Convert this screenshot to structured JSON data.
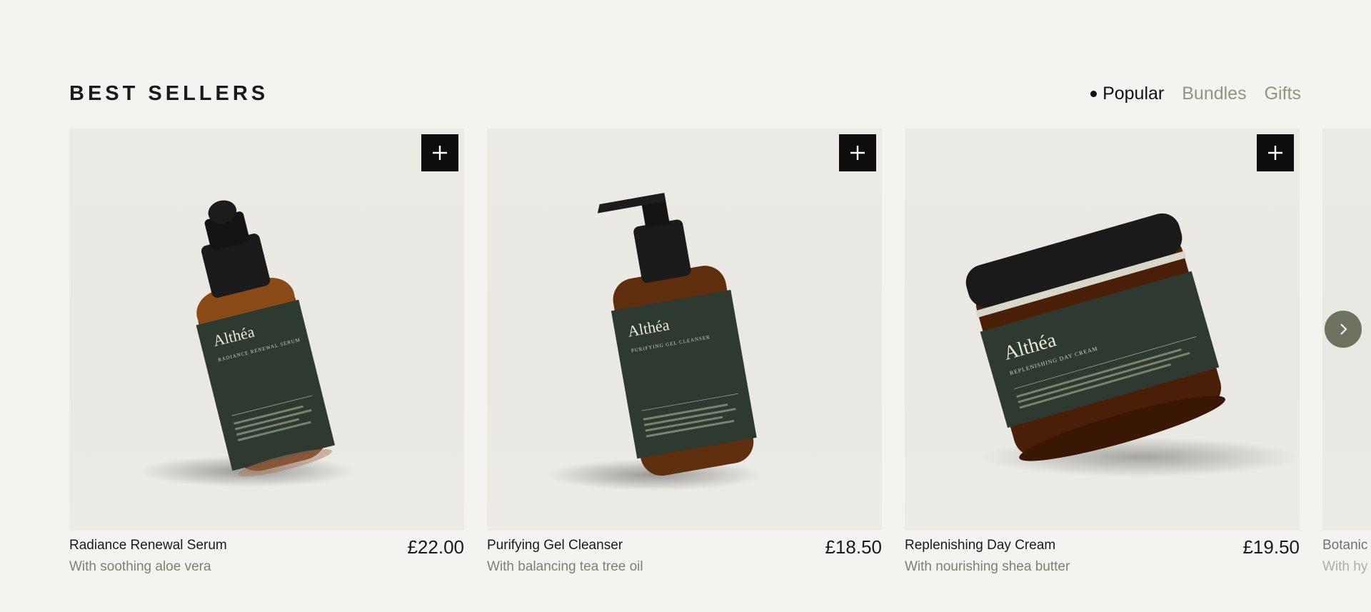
{
  "section": {
    "title": "BEST SELLERS"
  },
  "tabs": [
    {
      "label": "Popular",
      "active": true
    },
    {
      "label": "Bundles",
      "active": false
    },
    {
      "label": "Gifts",
      "active": false
    }
  ],
  "products": [
    {
      "name": "Radiance Renewal Serum",
      "description": "With soothing aloe vera",
      "price": "£22.00",
      "brand": "Althéa",
      "label_line": "RADIANCE RENEWAL SERUM"
    },
    {
      "name": "Purifying Gel Cleanser",
      "description": "With balancing tea tree oil",
      "price": "£18.50",
      "brand": "Althéa",
      "label_line": "PURIFYING GEL CLEANSER"
    },
    {
      "name": "Replenishing Day Cream",
      "description": "With nourishing shea butter",
      "price": "£19.50",
      "brand": "Althéa",
      "label_line": "REPLENISHING DAY CREAM"
    },
    {
      "name": "Botanic",
      "description": "With hy"
    }
  ],
  "icons": {
    "add": "plus-icon",
    "next": "chevron-right-icon"
  },
  "colors": {
    "background": "#f3f3f0",
    "accent": "#8f977e",
    "label_green": "#2e3a30",
    "button_dark": "#0d0d0d",
    "nav_button": "#6e7360"
  }
}
